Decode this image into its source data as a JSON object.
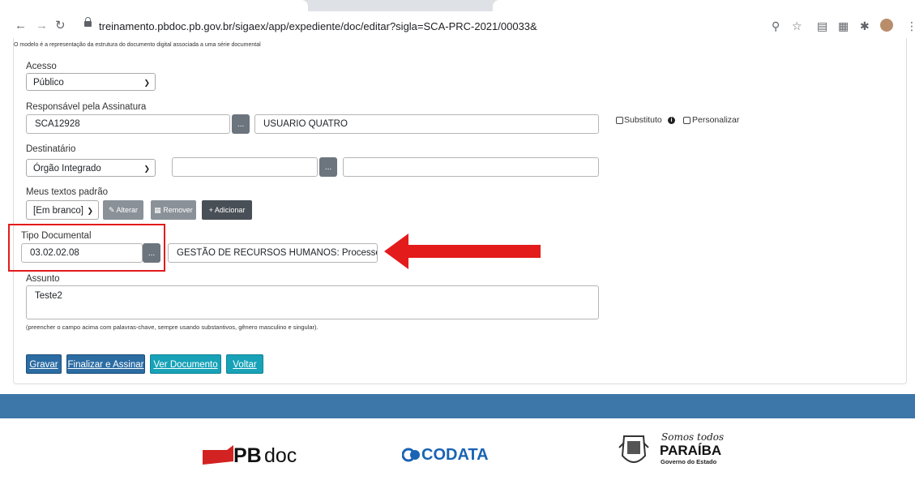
{
  "browser": {
    "url": "treinamento.pbdoc.pb.gov.br/sigaex/app/expediente/doc/editar?sigla=SCA-PRC-2021/00033&"
  },
  "form": {
    "model_note": "O modelo é a representação da estrutura do documento digital associada a uma série documental",
    "acesso": {
      "label": "Acesso",
      "value": "Público"
    },
    "responsavel": {
      "label": "Responsável pela Assinatura",
      "code": "SCA12928",
      "name": "USUARIO QUATRO",
      "substituto_label": "Substituto",
      "personalizar_label": "Personalizar"
    },
    "destinatario": {
      "label": "Destinatário",
      "value": "Órgão Integrado",
      "code": "",
      "name": ""
    },
    "textos": {
      "label": "Meus textos padrão",
      "value": "[Em branco]",
      "alterar": "Alterar",
      "remover": "Remover",
      "adicionar": "Adicionar"
    },
    "tipo": {
      "label": "Tipo Documental",
      "code": "03.02.02.08",
      "description": "GESTÃO DE RECURSOS HUMANOS: Processo de C..."
    },
    "assunto": {
      "label": "Assunto",
      "value": "Teste2",
      "hint": "(preencher o campo acima com palavras-chave, sempre usando substantivos, gênero masculino e singular)."
    },
    "dots": "..."
  },
  "actions": {
    "gravar": "Gravar",
    "finalizar": "Finalizar e Assinar",
    "ver": "Ver Documento",
    "voltar": "Voltar"
  },
  "footer": {
    "pbdoc": {
      "bold": "PB",
      "light": "doc"
    },
    "codata": "CODATA",
    "paraiba": {
      "script": "Somos todos",
      "name": "PARAÍBA",
      "sub": "Governo do Estado"
    }
  },
  "colors": {
    "primary_btn": "#2b6ca3",
    "teal_btn": "#17a2b8",
    "footer_bar": "#3d76a8",
    "highlight_red": "#e31b1b"
  }
}
